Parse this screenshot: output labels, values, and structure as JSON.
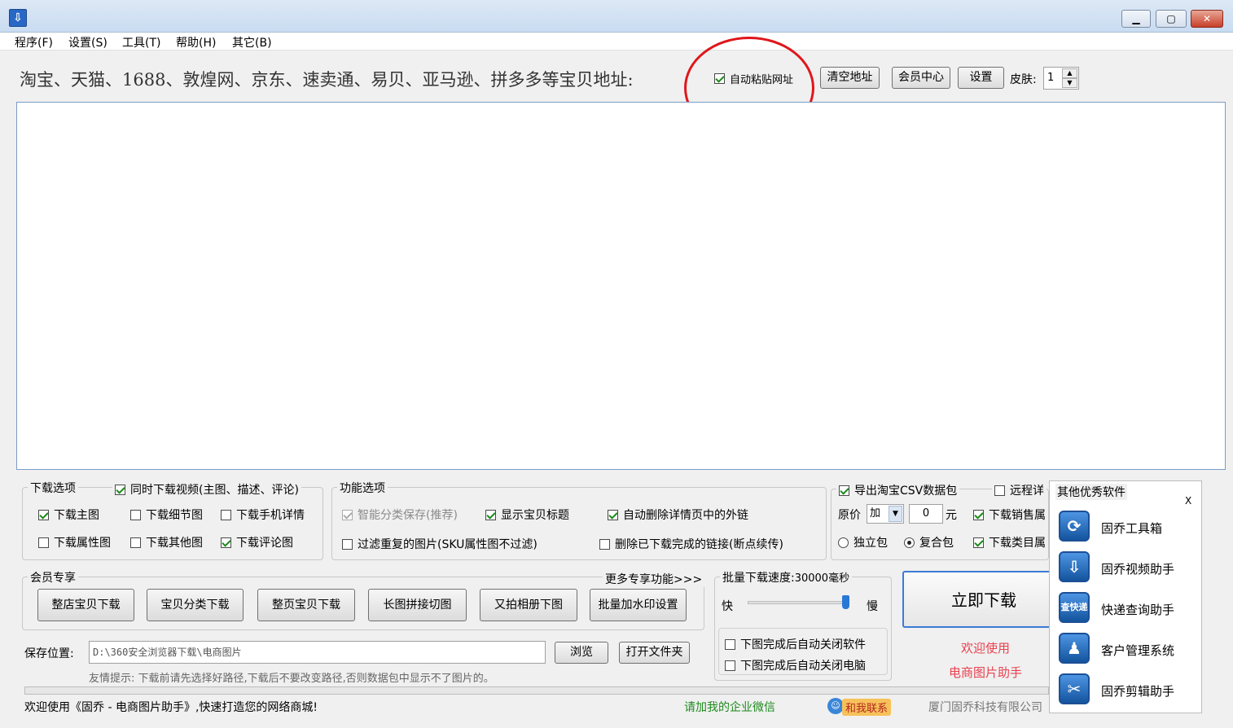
{
  "window": {
    "app_icon": "download-icon",
    "min": "▁",
    "max": "▢",
    "close": "✕"
  },
  "menu": [
    "程序(F)",
    "设置(S)",
    "工具(T)",
    "帮助(H)",
    "其它(B)"
  ],
  "top": {
    "url_label": "淘宝、天猫、1688、敦煌网、京东、速卖通、易贝、亚马逊、拼多多等宝贝地址:",
    "auto_paste": {
      "label": "自动粘贴网址",
      "checked": true
    },
    "clear_btn": "清空地址",
    "member_btn": "会员中心",
    "settings_btn": "设置",
    "skin_label": "皮肤:",
    "skin_value": "1"
  },
  "download_options": {
    "title": "下载选项",
    "video": "同时下载视频(主图、描述、评论)",
    "main_img": "下载主图",
    "detail_img": "下载细节图",
    "mobile_detail": "下载手机详情",
    "attr_img": "下载属性图",
    "other_img": "下载其他图",
    "review_img": "下载评论图"
  },
  "func_options": {
    "title": "功能选项",
    "smart_save": "智能分类保存(推荐)",
    "show_title": "显示宝贝标题",
    "auto_delete": "自动删除详情页中的外链",
    "filter_dup": "过滤重复的图片(SKU属性图不过滤)",
    "delete_done": "删除已下载完成的链接(断点续传)"
  },
  "export": {
    "csv": "导出淘宝CSV数据包",
    "remote": "远程详",
    "price_label": "原价",
    "price_op": "加",
    "price_value": "0",
    "yuan": "元",
    "sales": "下载销售属",
    "category": "下载类目属",
    "single": "独立包",
    "compound": "复合包"
  },
  "member": {
    "title": "会员专享",
    "more": "更多专享功能>>>",
    "buttons": [
      "整店宝贝下载",
      "宝贝分类下载",
      "整页宝贝下载",
      "长图拼接切图",
      "又拍相册下图",
      "批量加水印设置"
    ]
  },
  "speed": {
    "title": "批量下载速度:",
    "value": "30000毫秒",
    "fast": "快",
    "slow": "慢",
    "close_app": "下图完成后自动关闭软件",
    "close_pc": "下图完成后自动关闭电脑"
  },
  "download_now": "立即下载",
  "welcome": {
    "line1": "欢迎使用",
    "line2": "电商图片助手"
  },
  "save": {
    "label": "保存位置:",
    "path": "D:\\360安全浏览器下载\\电商图片",
    "browse": "浏览",
    "open_folder": "打开文件夹",
    "tip": "友情提示: 下载前请先选择好路径,下载后不要改变路径,否则数据包中显示不了图片的。"
  },
  "status": {
    "welcome": "欢迎使用《固乔 - 电商图片助手》,快速打造您的网络商城!",
    "wechat": "请加我的企业微信",
    "contact": "和我联系",
    "company": "厦门固乔科技有限公司"
  },
  "side_panel": {
    "title": "其他优秀软件",
    "close": "X",
    "items": [
      {
        "label": "固乔工具箱",
        "icon": "toolbox-icon"
      },
      {
        "label": "固乔视频助手",
        "icon": "video-download-icon"
      },
      {
        "label": "快递查询助手",
        "icon": "express-search-icon"
      },
      {
        "label": "客户管理系统",
        "icon": "customer-icon"
      },
      {
        "label": "固乔剪辑助手",
        "icon": "scissors-icon"
      }
    ]
  }
}
